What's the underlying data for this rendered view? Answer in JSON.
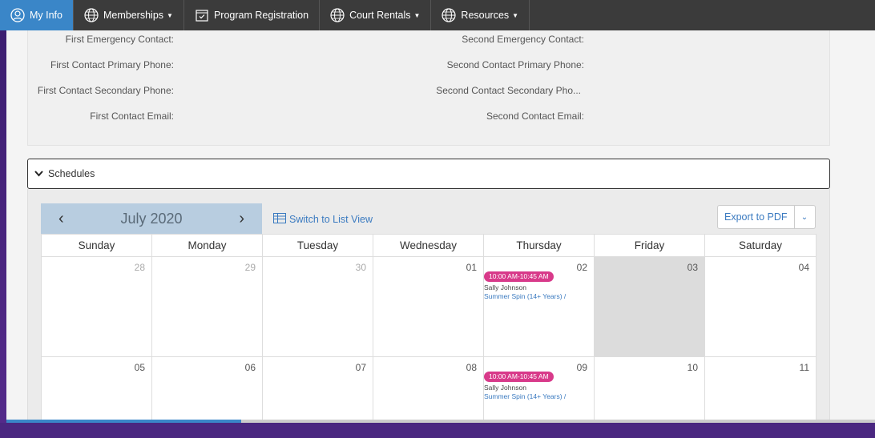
{
  "nav": {
    "items": [
      {
        "label": "My Info",
        "icon": "user-circle-icon",
        "active": true,
        "dropdown": false
      },
      {
        "label": "Memberships",
        "icon": "globe-icon",
        "active": false,
        "dropdown": true
      },
      {
        "label": "Program Registration",
        "icon": "calendar-check-icon",
        "active": false,
        "dropdown": false
      },
      {
        "label": "Court Rentals",
        "icon": "globe-icon",
        "active": false,
        "dropdown": true
      },
      {
        "label": "Resources",
        "icon": "globe-icon",
        "active": false,
        "dropdown": true
      }
    ]
  },
  "contacts": {
    "first_emergency": "First Emergency Contact:",
    "first_primary_phone": "First Contact Primary Phone:",
    "first_secondary_phone": "First Contact Secondary Phone:",
    "first_email": "First Contact Email:",
    "second_emergency": "Second Emergency Contact:",
    "second_primary_phone": "Second Contact Primary Phone:",
    "second_secondary_phone": "Second Contact Secondary Pho...",
    "second_email": "Second Contact Email:"
  },
  "schedules": {
    "title": "Schedules",
    "month": "July 2020",
    "switch_view": "Switch to List View",
    "export": "Export to PDF",
    "weekdays": [
      "Sunday",
      "Monday",
      "Tuesday",
      "Wednesday",
      "Thursday",
      "Friday",
      "Saturday"
    ],
    "week1": [
      "28",
      "29",
      "30",
      "01",
      "02",
      "03",
      "04"
    ],
    "week2": [
      "05",
      "06",
      "07",
      "08",
      "09",
      "10",
      "11"
    ],
    "events": [
      {
        "time": "10:00 AM-10:45 AM",
        "who": "Sally Johnson",
        "program": "Summer Spin (14+ Years) /"
      },
      {
        "time": "10:00 AM-10:45 AM",
        "who": "Sally Johnson",
        "program": "Summer Spin (14+ Years) /"
      }
    ]
  },
  "progress": 0.27,
  "colors": {
    "active_nav": "#3a86c8",
    "event_badge": "#d83a8a",
    "link": "#3a7ac0",
    "month_bar": "#b8cde0"
  }
}
